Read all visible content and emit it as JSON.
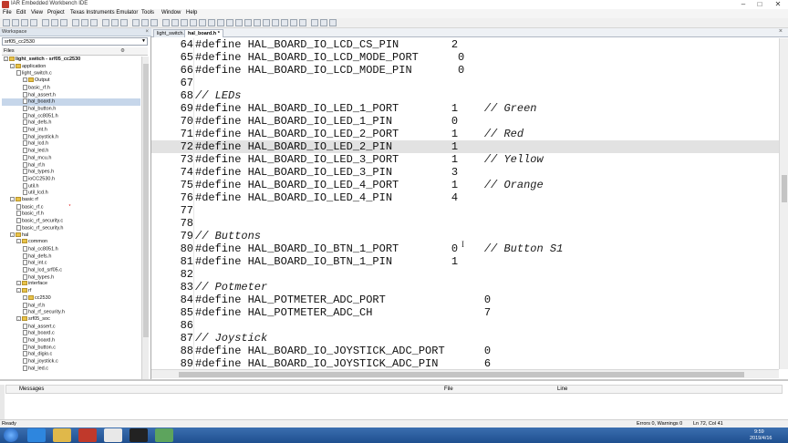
{
  "window": {
    "title": "IAR Embedded Workbench IDE"
  },
  "menu": [
    "File",
    "Edit",
    "View",
    "Project",
    "Texas Instruments Emulator",
    "Tools",
    "Window",
    "Help"
  ],
  "workspace": {
    "title": "Workspace",
    "config": "srf05_cc2530",
    "files_label": "Files",
    "tab": "light_switch",
    "tree": [
      {
        "label": "light_switch - srf05_cc2530",
        "kind": "project",
        "level": 0,
        "bold": true
      },
      {
        "label": "application",
        "kind": "folder",
        "level": 1
      },
      {
        "label": "light_switch.c",
        "kind": "file",
        "level": 2
      },
      {
        "label": "Output",
        "kind": "folder",
        "level": 3
      },
      {
        "label": "basic_rf.h",
        "kind": "file",
        "level": 3
      },
      {
        "label": "hal_assert.h",
        "kind": "file",
        "level": 3
      },
      {
        "label": "hal_board.h",
        "kind": "file",
        "level": 3,
        "selected": true
      },
      {
        "label": "hal_button.h",
        "kind": "file",
        "level": 3
      },
      {
        "label": "hal_cc8051.h",
        "kind": "file",
        "level": 3
      },
      {
        "label": "hal_defs.h",
        "kind": "file",
        "level": 3
      },
      {
        "label": "hal_int.h",
        "kind": "file",
        "level": 3
      },
      {
        "label": "hal_joystick.h",
        "kind": "file",
        "level": 3
      },
      {
        "label": "hal_lcd.h",
        "kind": "file",
        "level": 3
      },
      {
        "label": "hal_led.h",
        "kind": "file",
        "level": 3
      },
      {
        "label": "hal_mcu.h",
        "kind": "file",
        "level": 3
      },
      {
        "label": "hal_rf.h",
        "kind": "file",
        "level": 3
      },
      {
        "label": "hal_types.h",
        "kind": "file",
        "level": 3
      },
      {
        "label": "ioCC2530.h",
        "kind": "file",
        "level": 3
      },
      {
        "label": "util.h",
        "kind": "file",
        "level": 3
      },
      {
        "label": "util_lcd.h",
        "kind": "file",
        "level": 3
      },
      {
        "label": "basic rf",
        "kind": "folder",
        "level": 1
      },
      {
        "label": "basic_rf.c",
        "kind": "file",
        "level": 2,
        "mark": "*"
      },
      {
        "label": "basic_rf.h",
        "kind": "file",
        "level": 2
      },
      {
        "label": "basic_rf_security.c",
        "kind": "file",
        "level": 2
      },
      {
        "label": "basic_rf_security.h",
        "kind": "file",
        "level": 2
      },
      {
        "label": "hal",
        "kind": "folder",
        "level": 1
      },
      {
        "label": "common",
        "kind": "folder",
        "level": 2
      },
      {
        "label": "hal_cc8051.h",
        "kind": "file",
        "level": 3
      },
      {
        "label": "hal_defs.h",
        "kind": "file",
        "level": 3
      },
      {
        "label": "hal_int.c",
        "kind": "file",
        "level": 3
      },
      {
        "label": "hal_lcd_srf05.c",
        "kind": "file",
        "level": 3
      },
      {
        "label": "hal_types.h",
        "kind": "file",
        "level": 3
      },
      {
        "label": "interface",
        "kind": "folder",
        "level": 2
      },
      {
        "label": "rf",
        "kind": "folder",
        "level": 2
      },
      {
        "label": "cc2530",
        "kind": "folder",
        "level": 3
      },
      {
        "label": "hal_rf.h",
        "kind": "file",
        "level": 3
      },
      {
        "label": "hal_rf_security.h",
        "kind": "file",
        "level": 3
      },
      {
        "label": "srf05_soc",
        "kind": "folder",
        "level": 2
      },
      {
        "label": "hal_assert.c",
        "kind": "file",
        "level": 3
      },
      {
        "label": "hal_board.c",
        "kind": "file",
        "level": 3
      },
      {
        "label": "hal_board.h",
        "kind": "file",
        "level": 3
      },
      {
        "label": "hal_button.c",
        "kind": "file",
        "level": 3
      },
      {
        "label": "hal_digio.c",
        "kind": "file",
        "level": 3
      },
      {
        "label": "hal_joystick.c",
        "kind": "file",
        "level": 3
      },
      {
        "label": "hal_led.c",
        "kind": "file",
        "level": 3
      }
    ]
  },
  "editor": {
    "tabs": [
      {
        "label": "light_switch.c",
        "active": false
      },
      {
        "label": "hal_board.h *",
        "active": true
      }
    ],
    "current_line": 72,
    "lines": [
      {
        "n": "64",
        "code": "#define HAL_BOARD_IO_LCD_CS_PIN        2"
      },
      {
        "n": "65",
        "code": "#define HAL_BOARD_IO_LCD_MODE_PORT      0"
      },
      {
        "n": "66",
        "code": "#define HAL_BOARD_IO_LCD_MODE_PIN       0"
      },
      {
        "n": "67",
        "code": ""
      },
      {
        "n": "68",
        "code": "// LEDs"
      },
      {
        "n": "69",
        "code": "#define HAL_BOARD_IO_LED_1_PORT        1    // Green"
      },
      {
        "n": "70",
        "code": "#define HAL_BOARD_IO_LED_1_PIN         0"
      },
      {
        "n": "71",
        "code": "#define HAL_BOARD_IO_LED_2_PORT        1    // Red"
      },
      {
        "n": "72",
        "code": "#define HAL_BOARD_IO_LED_2_PIN         1"
      },
      {
        "n": "73",
        "code": "#define HAL_BOARD_IO_LED_3_PORT        1    // Yellow"
      },
      {
        "n": "74",
        "code": "#define HAL_BOARD_IO_LED_3_PIN         3"
      },
      {
        "n": "75",
        "code": "#define HAL_BOARD_IO_LED_4_PORT        1    // Orange"
      },
      {
        "n": "76",
        "code": "#define HAL_BOARD_IO_LED_4_PIN         4"
      },
      {
        "n": "77",
        "code": ""
      },
      {
        "n": "78",
        "code": ""
      },
      {
        "n": "79",
        "code": "// Buttons"
      },
      {
        "n": "80",
        "code": "#define HAL_BOARD_IO_BTN_1_PORT        0    // Button S1"
      },
      {
        "n": "81",
        "code": "#define HAL_BOARD_IO_BTN_1_PIN         1"
      },
      {
        "n": "82",
        "code": ""
      },
      {
        "n": "83",
        "code": "// Potmeter"
      },
      {
        "n": "84",
        "code": "#define HAL_POTMETER_ADC_PORT               0"
      },
      {
        "n": "85",
        "code": "#define HAL_POTMETER_ADC_CH                 7"
      },
      {
        "n": "86",
        "code": ""
      },
      {
        "n": "87",
        "code": "// Joystick"
      },
      {
        "n": "88",
        "code": "#define HAL_BOARD_IO_JOYSTICK_ADC_PORT      0"
      },
      {
        "n": "89",
        "code": "#define HAL_BOARD_IO_JOYSTICK_ADC_PIN       6"
      }
    ]
  },
  "messages": {
    "col_messages": "Messages",
    "col_file": "File",
    "col_line": "Line"
  },
  "status": {
    "left": "Ready",
    "errors": "Errors 0, Warnings 0",
    "position": "Ln 72, Col 41"
  },
  "taskbar": {
    "time": "9:59",
    "date": "2019/4/16"
  }
}
